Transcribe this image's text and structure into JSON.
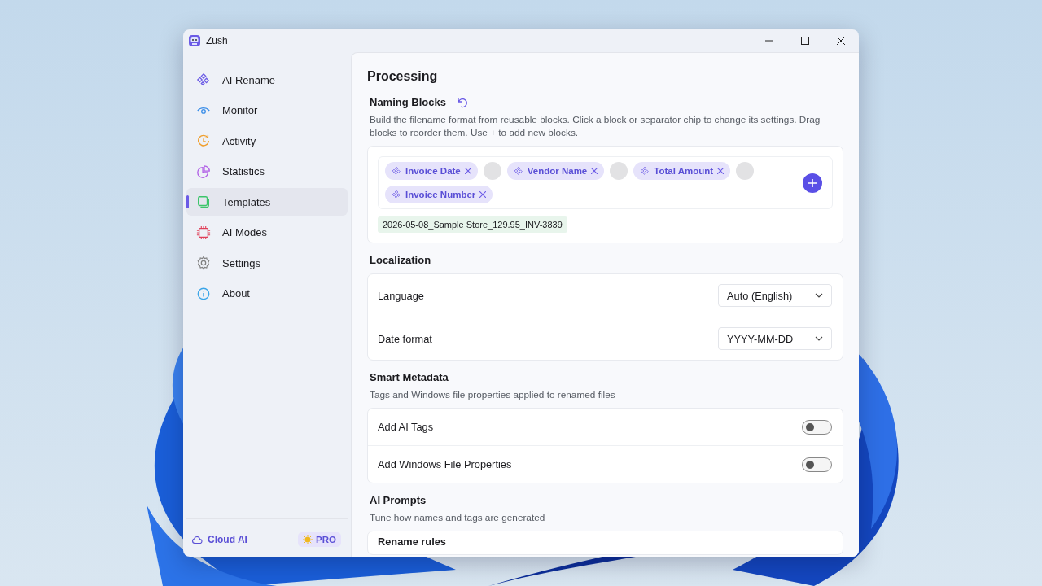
{
  "window": {
    "title": "Zush"
  },
  "sidebar": {
    "items": [
      {
        "label": "AI Rename",
        "selected": false
      },
      {
        "label": "Monitor",
        "selected": false
      },
      {
        "label": "Activity",
        "selected": false
      },
      {
        "label": "Statistics",
        "selected": false
      },
      {
        "label": "Templates",
        "selected": true
      },
      {
        "label": "AI Modes",
        "selected": false
      },
      {
        "label": "Settings",
        "selected": false
      },
      {
        "label": "About",
        "selected": false
      }
    ],
    "footer": {
      "cloud": "Cloud AI",
      "badge": "PRO"
    }
  },
  "page": {
    "title": "Processing"
  },
  "naming_blocks": {
    "title": "Naming Blocks",
    "description": "Build the filename format from reusable blocks. Click a block or separator chip to change its settings. Drag blocks to reorder them. Use + to add new blocks.",
    "chips": [
      {
        "kind": "block",
        "label": "Invoice Date"
      },
      {
        "kind": "separator",
        "label": "_"
      },
      {
        "kind": "block",
        "label": "Vendor Name"
      },
      {
        "kind": "separator",
        "label": "_"
      },
      {
        "kind": "block",
        "label": "Total Amount"
      },
      {
        "kind": "separator",
        "label": "_"
      },
      {
        "kind": "block",
        "label": "Invoice Number"
      }
    ],
    "preview": "2026-05-08_Sample Store_129.95_INV-3839"
  },
  "localization": {
    "title": "Localization",
    "rows": [
      {
        "label": "Language",
        "value": "Auto (English)"
      },
      {
        "label": "Date format",
        "value": "YYYY-MM-DD"
      }
    ]
  },
  "smart_metadata": {
    "title": "Smart Metadata",
    "subtitle": "Tags and Windows file properties applied to renamed files",
    "rows": [
      {
        "label": "Add AI Tags",
        "on": false
      },
      {
        "label": "Add Windows File Properties",
        "on": false
      }
    ]
  },
  "ai_prompts": {
    "title": "AI Prompts",
    "subtitle": "Tune how names and tags are generated",
    "rows": [
      {
        "label": "Rename rules"
      }
    ]
  }
}
